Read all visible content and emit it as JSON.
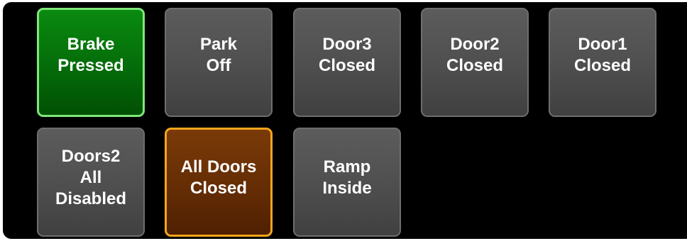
{
  "tiles": {
    "brake": {
      "line1": "Brake",
      "line2": "Pressed"
    },
    "park": {
      "line1": "Park",
      "line2": "Off"
    },
    "door3": {
      "line1": "Door3",
      "line2": "Closed"
    },
    "door2": {
      "line1": "Door2",
      "line2": "Closed"
    },
    "door1": {
      "line1": "Door1",
      "line2": "Closed"
    },
    "doors2": {
      "line1": "Doors2",
      "line2": "All",
      "line3": "Disabled"
    },
    "alldoors": {
      "line1": "All Doors",
      "line2": "Closed"
    },
    "ramp": {
      "line1": "Ramp",
      "line2": "Inside"
    }
  },
  "colors": {
    "panel_background": "#000000",
    "tile_neutral": "#4e4e4e",
    "tile_active_green": "#046c09",
    "tile_active_green_border": "#7fe77a",
    "tile_warning_orange": "#652d04",
    "tile_warning_orange_border": "#f5a51c",
    "text": "#ffffff"
  }
}
